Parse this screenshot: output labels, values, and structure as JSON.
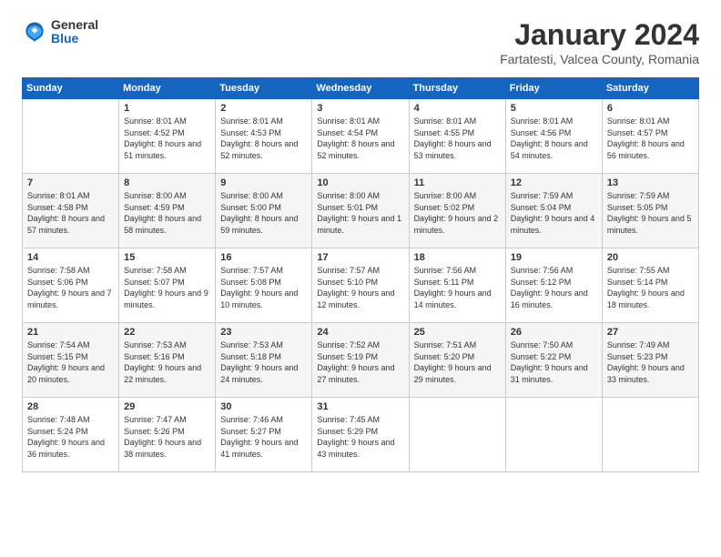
{
  "header": {
    "logo_general": "General",
    "logo_blue": "Blue",
    "title": "January 2024",
    "location": "Fartatesti, Valcea County, Romania"
  },
  "days_of_week": [
    "Sunday",
    "Monday",
    "Tuesday",
    "Wednesday",
    "Thursday",
    "Friday",
    "Saturday"
  ],
  "weeks": [
    [
      {
        "day": "",
        "sunrise": "",
        "sunset": "",
        "daylight": ""
      },
      {
        "day": "1",
        "sunrise": "Sunrise: 8:01 AM",
        "sunset": "Sunset: 4:52 PM",
        "daylight": "Daylight: 8 hours and 51 minutes."
      },
      {
        "day": "2",
        "sunrise": "Sunrise: 8:01 AM",
        "sunset": "Sunset: 4:53 PM",
        "daylight": "Daylight: 8 hours and 52 minutes."
      },
      {
        "day": "3",
        "sunrise": "Sunrise: 8:01 AM",
        "sunset": "Sunset: 4:54 PM",
        "daylight": "Daylight: 8 hours and 52 minutes."
      },
      {
        "day": "4",
        "sunrise": "Sunrise: 8:01 AM",
        "sunset": "Sunset: 4:55 PM",
        "daylight": "Daylight: 8 hours and 53 minutes."
      },
      {
        "day": "5",
        "sunrise": "Sunrise: 8:01 AM",
        "sunset": "Sunset: 4:56 PM",
        "daylight": "Daylight: 8 hours and 54 minutes."
      },
      {
        "day": "6",
        "sunrise": "Sunrise: 8:01 AM",
        "sunset": "Sunset: 4:57 PM",
        "daylight": "Daylight: 8 hours and 56 minutes."
      }
    ],
    [
      {
        "day": "7",
        "sunrise": "Sunrise: 8:01 AM",
        "sunset": "Sunset: 4:58 PM",
        "daylight": "Daylight: 8 hours and 57 minutes."
      },
      {
        "day": "8",
        "sunrise": "Sunrise: 8:00 AM",
        "sunset": "Sunset: 4:59 PM",
        "daylight": "Daylight: 8 hours and 58 minutes."
      },
      {
        "day": "9",
        "sunrise": "Sunrise: 8:00 AM",
        "sunset": "Sunset: 5:00 PM",
        "daylight": "Daylight: 8 hours and 59 minutes."
      },
      {
        "day": "10",
        "sunrise": "Sunrise: 8:00 AM",
        "sunset": "Sunset: 5:01 PM",
        "daylight": "Daylight: 9 hours and 1 minute."
      },
      {
        "day": "11",
        "sunrise": "Sunrise: 8:00 AM",
        "sunset": "Sunset: 5:02 PM",
        "daylight": "Daylight: 9 hours and 2 minutes."
      },
      {
        "day": "12",
        "sunrise": "Sunrise: 7:59 AM",
        "sunset": "Sunset: 5:04 PM",
        "daylight": "Daylight: 9 hours and 4 minutes."
      },
      {
        "day": "13",
        "sunrise": "Sunrise: 7:59 AM",
        "sunset": "Sunset: 5:05 PM",
        "daylight": "Daylight: 9 hours and 5 minutes."
      }
    ],
    [
      {
        "day": "14",
        "sunrise": "Sunrise: 7:58 AM",
        "sunset": "Sunset: 5:06 PM",
        "daylight": "Daylight: 9 hours and 7 minutes."
      },
      {
        "day": "15",
        "sunrise": "Sunrise: 7:58 AM",
        "sunset": "Sunset: 5:07 PM",
        "daylight": "Daylight: 9 hours and 9 minutes."
      },
      {
        "day": "16",
        "sunrise": "Sunrise: 7:57 AM",
        "sunset": "Sunset: 5:08 PM",
        "daylight": "Daylight: 9 hours and 10 minutes."
      },
      {
        "day": "17",
        "sunrise": "Sunrise: 7:57 AM",
        "sunset": "Sunset: 5:10 PM",
        "daylight": "Daylight: 9 hours and 12 minutes."
      },
      {
        "day": "18",
        "sunrise": "Sunrise: 7:56 AM",
        "sunset": "Sunset: 5:11 PM",
        "daylight": "Daylight: 9 hours and 14 minutes."
      },
      {
        "day": "19",
        "sunrise": "Sunrise: 7:56 AM",
        "sunset": "Sunset: 5:12 PM",
        "daylight": "Daylight: 9 hours and 16 minutes."
      },
      {
        "day": "20",
        "sunrise": "Sunrise: 7:55 AM",
        "sunset": "Sunset: 5:14 PM",
        "daylight": "Daylight: 9 hours and 18 minutes."
      }
    ],
    [
      {
        "day": "21",
        "sunrise": "Sunrise: 7:54 AM",
        "sunset": "Sunset: 5:15 PM",
        "daylight": "Daylight: 9 hours and 20 minutes."
      },
      {
        "day": "22",
        "sunrise": "Sunrise: 7:53 AM",
        "sunset": "Sunset: 5:16 PM",
        "daylight": "Daylight: 9 hours and 22 minutes."
      },
      {
        "day": "23",
        "sunrise": "Sunrise: 7:53 AM",
        "sunset": "Sunset: 5:18 PM",
        "daylight": "Daylight: 9 hours and 24 minutes."
      },
      {
        "day": "24",
        "sunrise": "Sunrise: 7:52 AM",
        "sunset": "Sunset: 5:19 PM",
        "daylight": "Daylight: 9 hours and 27 minutes."
      },
      {
        "day": "25",
        "sunrise": "Sunrise: 7:51 AM",
        "sunset": "Sunset: 5:20 PM",
        "daylight": "Daylight: 9 hours and 29 minutes."
      },
      {
        "day": "26",
        "sunrise": "Sunrise: 7:50 AM",
        "sunset": "Sunset: 5:22 PM",
        "daylight": "Daylight: 9 hours and 31 minutes."
      },
      {
        "day": "27",
        "sunrise": "Sunrise: 7:49 AM",
        "sunset": "Sunset: 5:23 PM",
        "daylight": "Daylight: 9 hours and 33 minutes."
      }
    ],
    [
      {
        "day": "28",
        "sunrise": "Sunrise: 7:48 AM",
        "sunset": "Sunset: 5:24 PM",
        "daylight": "Daylight: 9 hours and 36 minutes."
      },
      {
        "day": "29",
        "sunrise": "Sunrise: 7:47 AM",
        "sunset": "Sunset: 5:26 PM",
        "daylight": "Daylight: 9 hours and 38 minutes."
      },
      {
        "day": "30",
        "sunrise": "Sunrise: 7:46 AM",
        "sunset": "Sunset: 5:27 PM",
        "daylight": "Daylight: 9 hours and 41 minutes."
      },
      {
        "day": "31",
        "sunrise": "Sunrise: 7:45 AM",
        "sunset": "Sunset: 5:29 PM",
        "daylight": "Daylight: 9 hours and 43 minutes."
      },
      {
        "day": "",
        "sunrise": "",
        "sunset": "",
        "daylight": ""
      },
      {
        "day": "",
        "sunrise": "",
        "sunset": "",
        "daylight": ""
      },
      {
        "day": "",
        "sunrise": "",
        "sunset": "",
        "daylight": ""
      }
    ]
  ]
}
